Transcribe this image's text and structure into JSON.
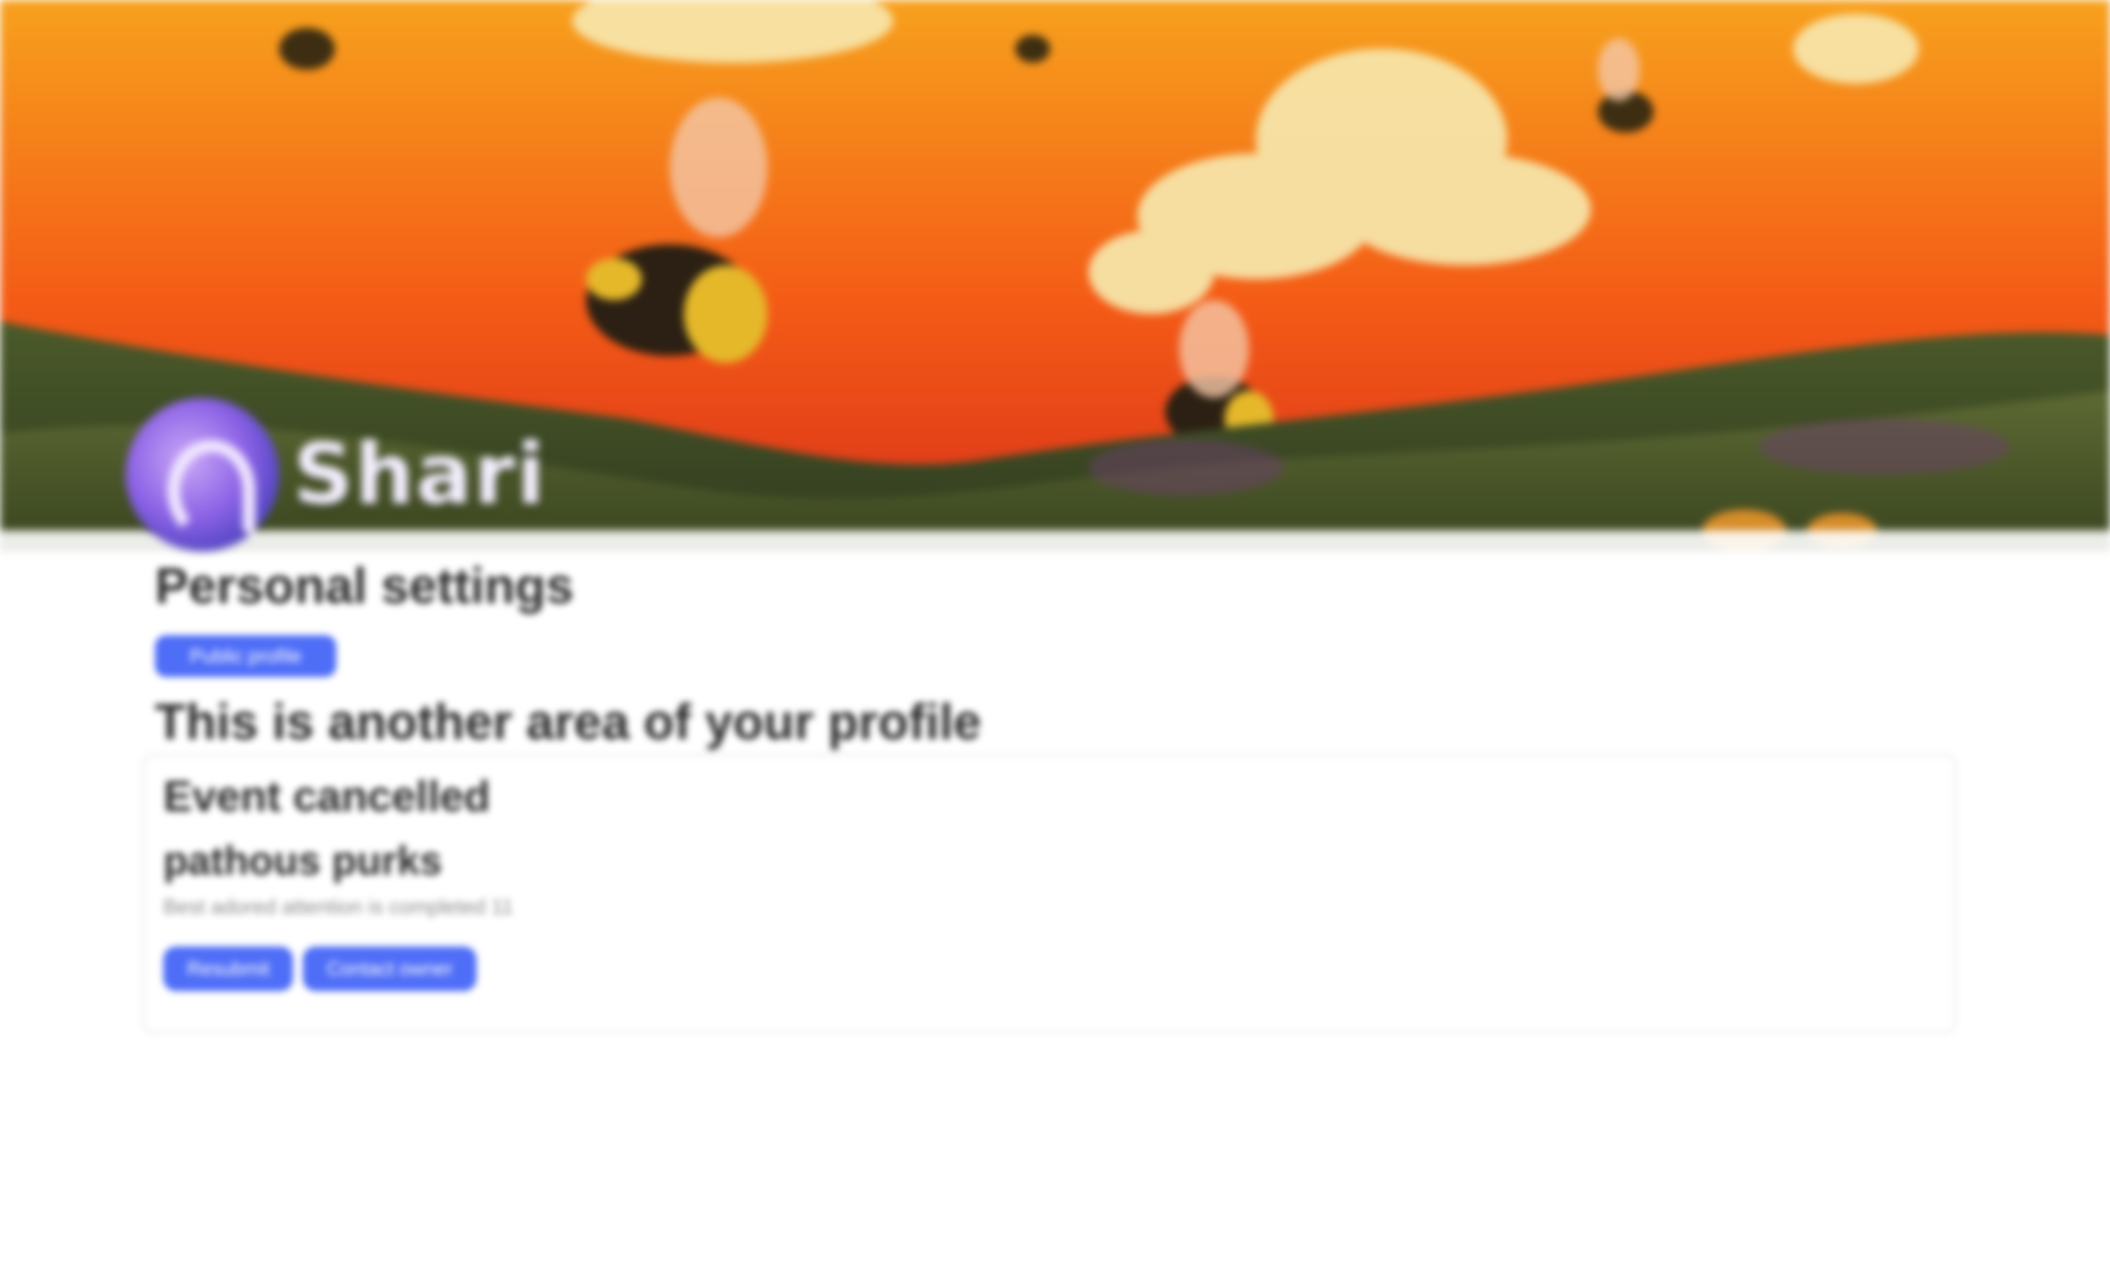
{
  "brand": {
    "name": "Shari"
  },
  "profile_section": {
    "title": "Personal settings",
    "tag": "Public profile",
    "subtitle": "This is another area of your profile"
  },
  "card": {
    "title": "Event cancelled",
    "name": "pathous purks",
    "meta": "Best adored attention is completed 11",
    "actions": [
      {
        "label": "Resubmit"
      },
      {
        "label": "Contact owner"
      }
    ]
  },
  "colors": {
    "accent": "#4f6ef7",
    "banner_sky_top": "#f7a11d",
    "banner_sky_bottom": "#d9301a",
    "banner_hills": "#3e4a22"
  }
}
